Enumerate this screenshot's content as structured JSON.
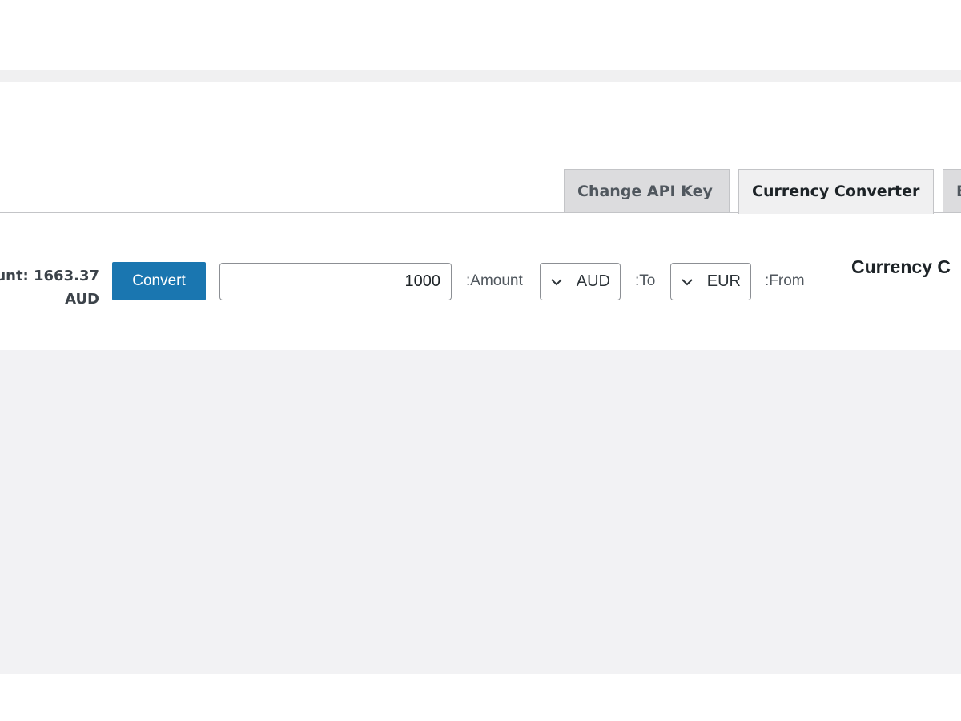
{
  "tabs": [
    {
      "label": "Change API Key",
      "active": false
    },
    {
      "label": "Currency Converter",
      "active": true
    },
    {
      "label": "E",
      "active": false
    }
  ],
  "converter": {
    "heading": "Currency C",
    "from_label": ":From",
    "from_value": "EUR",
    "to_label": ":To",
    "to_value": "AUD",
    "amount_label": ":Amount",
    "amount_value": "1000",
    "convert_label": "Convert",
    "result_text": "unt: 1663.37 AUD"
  },
  "icons": {
    "select_chevron": "chevron-down-icon"
  },
  "colors": {
    "button_bg": "#1a76b0",
    "content_bg": "#f2f2f4",
    "tab_inactive_bg": "#dcdcde"
  }
}
